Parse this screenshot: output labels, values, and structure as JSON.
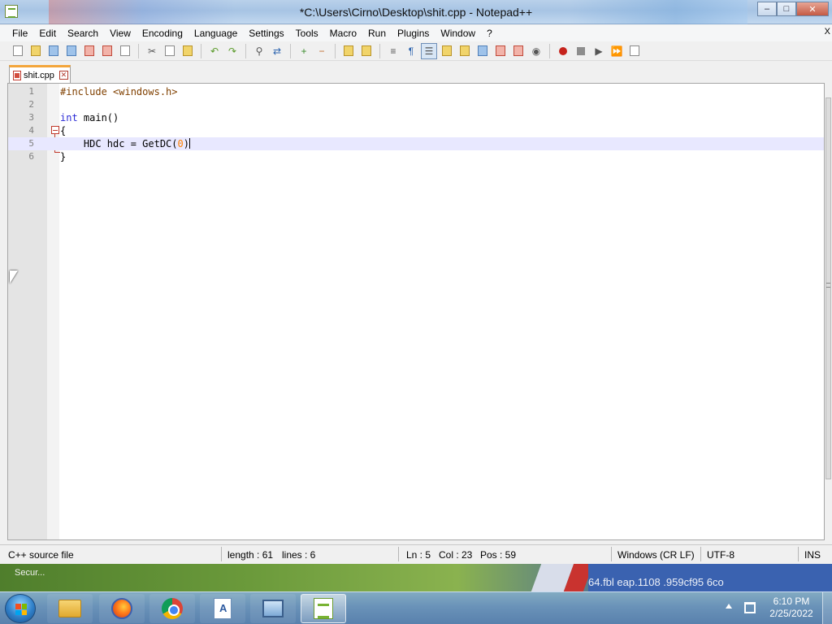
{
  "window": {
    "title": "*C:\\Users\\Cirno\\Desktop\\shit.cpp - Notepad++",
    "controls": {
      "minimize": "–",
      "maximize": "□",
      "close": "✕"
    }
  },
  "menu": {
    "items": [
      "File",
      "Edit",
      "Search",
      "View",
      "Encoding",
      "Language",
      "Settings",
      "Tools",
      "Macro",
      "Run",
      "Plugins",
      "Window",
      "?"
    ],
    "close_glyph": "X"
  },
  "tabs": [
    {
      "label": "shit.cpp",
      "modified": true,
      "close_glyph": "✕"
    }
  ],
  "editor": {
    "current_line": 5,
    "line_numbers": [
      "1",
      "2",
      "3",
      "4",
      "5",
      "6"
    ],
    "lines": {
      "l1_pre": "#include <windows.h>",
      "l3_kw": "int",
      "l3_rest": " main()",
      "l4": "{",
      "l5_indent": "    ",
      "l5_code": "HDC hdc = GetDC(",
      "l5_num": "0",
      "l5_close": ")",
      "l6": "}"
    }
  },
  "statusbar": {
    "file_type": "C++ source file",
    "length": "length : 61",
    "lines": "lines : 6",
    "ln": "Ln : 5",
    "col": "Col : 23",
    "pos": "Pos : 59",
    "eol": "Windows (CR LF)",
    "encoding": "UTF-8",
    "mode": "INS"
  },
  "desktop": {
    "label": "Secur...",
    "background_text": "64.fbl  eap.1108     .959cf95      6co"
  },
  "taskbar": {
    "apps": [
      "Windows Explorer",
      "Firefox",
      "Google Chrome",
      "WordPad",
      "Remote Desktop",
      "Notepad++"
    ],
    "clock_time": "6:10 PM",
    "clock_date": "2/25/2022"
  },
  "colors": {
    "keyword": "#2b2bd6",
    "preprocessor": "#804000",
    "number": "#ff8000",
    "current_line_bg": "#e8e8ff",
    "tab_accent": "#f3a53a"
  },
  "icons": {
    "toolbar": [
      "new-file-icon",
      "open-file-icon",
      "save-icon",
      "save-all-icon",
      "close-file-icon",
      "close-all-icon",
      "print-icon",
      "cut-icon",
      "copy-icon",
      "paste-icon",
      "undo-icon",
      "redo-icon",
      "find-icon",
      "replace-icon",
      "zoom-in-icon",
      "zoom-out-icon",
      "sync-vertical-icon",
      "sync-horizontal-icon",
      "word-wrap-icon",
      "show-all-chars-icon",
      "indent-guide-icon",
      "udl-icon",
      "doc-map-icon",
      "function-list-icon",
      "folder-workspace-icon",
      "monitoring-icon",
      "macro-record-icon",
      "macro-stop-icon",
      "macro-play-icon",
      "macro-run-multiple-icon",
      "macro-save-icon"
    ]
  }
}
